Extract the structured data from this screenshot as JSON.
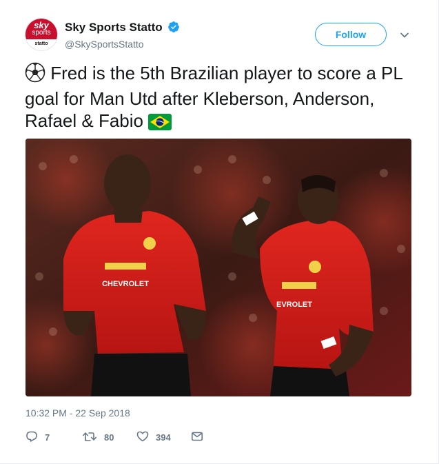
{
  "account": {
    "display_name": "Sky Sports Statto",
    "handle": "@SkySportsStatto",
    "avatar": {
      "line1": "sky",
      "line2": "sports",
      "line3": "statto"
    },
    "verified": true
  },
  "follow_label": "Follow",
  "tweet": {
    "text": "Fred is the 5th Brazilian player to score a PL goal for Man Utd after Kleberson, Anderson, Rafael & Fabio",
    "leading_emoji": "soccer-ball-icon",
    "trailing_emoji": "brazil-flag-icon"
  },
  "timestamp": "10:32 PM - 22 Sep 2018",
  "actions": {
    "replies": "7",
    "retweets": "80",
    "likes": "394"
  },
  "colors": {
    "accent": "#1da1f2",
    "muted": "#657786",
    "text": "#14171a",
    "sky_red": "#c8102e"
  }
}
